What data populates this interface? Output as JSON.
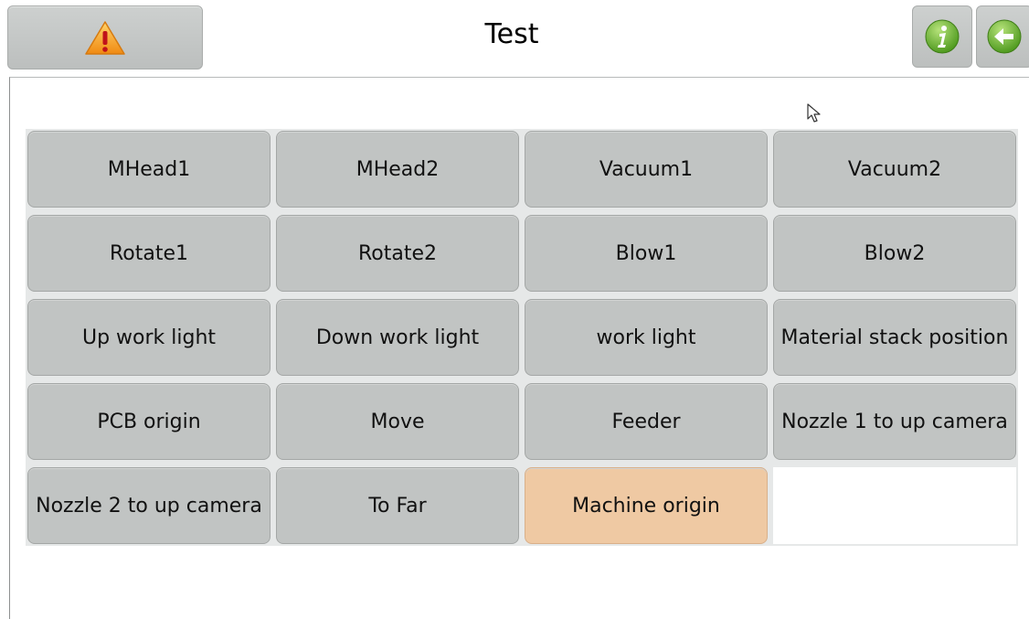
{
  "header": {
    "title": "Test",
    "warning_icon": "warning-triangle-icon",
    "info_icon": "info-icon",
    "back_icon": "back-arrow-icon"
  },
  "buttons": [
    {
      "label": "MHead1",
      "active": false
    },
    {
      "label": "MHead2",
      "active": false
    },
    {
      "label": "Vacuum1",
      "active": false
    },
    {
      "label": "Vacuum2",
      "active": false
    },
    {
      "label": "Rotate1",
      "active": false
    },
    {
      "label": "Rotate2",
      "active": false
    },
    {
      "label": "Blow1",
      "active": false
    },
    {
      "label": "Blow2",
      "active": false
    },
    {
      "label": "Up work light",
      "active": false
    },
    {
      "label": "Down work light",
      "active": false
    },
    {
      "label": "work light",
      "active": false
    },
    {
      "label": "Material stack position",
      "active": false
    },
    {
      "label": "PCB origin",
      "active": false
    },
    {
      "label": "Move",
      "active": false
    },
    {
      "label": "Feeder",
      "active": false
    },
    {
      "label": "Nozzle 1 to up camera",
      "active": false
    },
    {
      "label": "Nozzle 2 to up camera",
      "active": false
    },
    {
      "label": "To Far",
      "active": false
    },
    {
      "label": "Machine origin",
      "active": true
    }
  ],
  "colors": {
    "button_bg": "#c1c4c3",
    "active_bg": "#efc9a3",
    "icon_green": "#7cc243",
    "warning_orange": "#f2a01c"
  }
}
